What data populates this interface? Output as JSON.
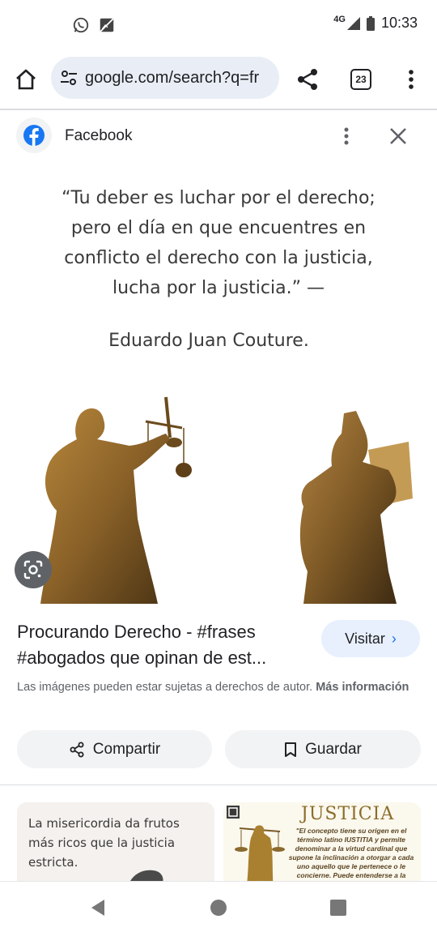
{
  "status_bar": {
    "network": "4G",
    "time": "10:33",
    "icons": [
      "whatsapp-icon",
      "no-image-icon",
      "signal-icon",
      "battery-icon"
    ]
  },
  "toolbar": {
    "url": "google.com/search?q=fr",
    "tab_count": "23",
    "icons": [
      "home-icon",
      "tune-icon",
      "share-icon",
      "tabs-icon",
      "more-vert-icon"
    ]
  },
  "source": {
    "name": "Facebook",
    "brand_color": "#1877f2"
  },
  "image": {
    "quote_lines": [
      "“Tu deber es luchar por el derecho;",
      "pero el día en que encuentres en",
      "conflicto el derecho con la justicia,",
      "lucha por la justicia.” —"
    ],
    "author": "Eduardo Juan Couture."
  },
  "result": {
    "title": "Procurando Derecho - #frases #abogados que opinan de est...",
    "visit_label": "Visitar",
    "copyright_text": "Las imágenes pueden estar sujetas a derechos de autor.",
    "more_info_label": "Más información"
  },
  "actions": {
    "share_label": "Compartir",
    "save_label": "Guardar"
  },
  "related": [
    {
      "text_lines": [
        "La misericordia da frutos",
        "más ricos que la justicia",
        "estricta."
      ]
    },
    {
      "heading": "JUSTICIA",
      "body": "\"El concepto tiene su origen en el término latino IUSTITIA y permite denominar a la virtud cardinal que supone la inclinación a otorgar a cada uno aquello que le pertenece o le concierne. Puede entenderse a la"
    }
  ],
  "colors": {
    "omnibox_bg": "#e9eef6",
    "visit_bg": "#e8f0fe",
    "chip_bg": "#f1f3f4",
    "accent": "#1a73e8"
  }
}
